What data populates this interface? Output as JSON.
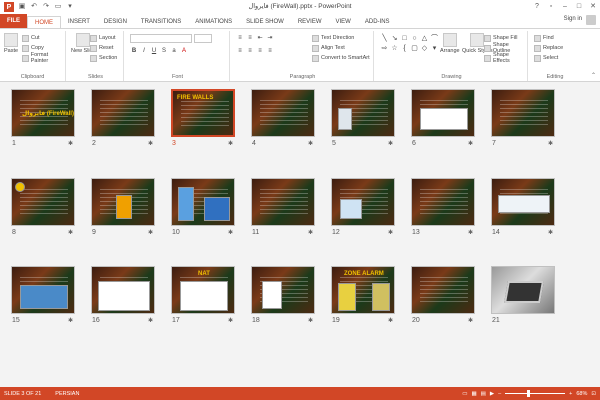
{
  "window": {
    "title": "فايروال (FireWall).pptx - PowerPoint"
  },
  "qat": {
    "logo": "P"
  },
  "tabs": [
    "FILE",
    "HOME",
    "INSERT",
    "DESIGN",
    "TRANSITIONS",
    "ANIMATIONS",
    "SLIDE SHOW",
    "REVIEW",
    "VIEW",
    "ADD-INS"
  ],
  "account": {
    "signin": "Sign in"
  },
  "ribbon": {
    "clipboard": {
      "label": "Clipboard",
      "paste": "Paste",
      "cut": "Cut",
      "copy": "Copy",
      "format_painter": "Format Painter"
    },
    "slides": {
      "label": "Slides",
      "new_slide": "New Slide",
      "layout": "Layout",
      "reset": "Reset",
      "section": "Section"
    },
    "font": {
      "label": "Font"
    },
    "paragraph": {
      "label": "Paragraph",
      "text_direction": "Text Direction",
      "align_text": "Align Text",
      "convert_smartart": "Convert to SmartArt"
    },
    "drawing": {
      "label": "Drawing",
      "arrange": "Arrange",
      "quick_styles": "Quick Styles",
      "shape_fill": "Shape Fill",
      "shape_outline": "Shape Outline",
      "shape_effects": "Shape Effects"
    },
    "editing": {
      "label": "Editing",
      "find": "Find",
      "replace": "Replace",
      "select": "Select"
    }
  },
  "slides": {
    "items": [
      {
        "n": "1",
        "title": "فايروال (FireWall)"
      },
      {
        "n": "2",
        "title": ""
      },
      {
        "n": "3",
        "title": "FIRE WALLS"
      },
      {
        "n": "4",
        "title": ""
      },
      {
        "n": "5",
        "title": ""
      },
      {
        "n": "6",
        "title": ""
      },
      {
        "n": "7",
        "title": ""
      },
      {
        "n": "8",
        "title": ""
      },
      {
        "n": "9",
        "title": ""
      },
      {
        "n": "10",
        "title": ""
      },
      {
        "n": "11",
        "title": ""
      },
      {
        "n": "12",
        "title": ""
      },
      {
        "n": "13",
        "title": ""
      },
      {
        "n": "14",
        "title": ""
      },
      {
        "n": "15",
        "title": ""
      },
      {
        "n": "16",
        "title": ""
      },
      {
        "n": "17",
        "title": "NAT"
      },
      {
        "n": "18",
        "title": ""
      },
      {
        "n": "19",
        "title": "ZONE ALARM"
      },
      {
        "n": "20",
        "title": ""
      },
      {
        "n": "21",
        "title": ""
      }
    ],
    "star": "✱"
  },
  "status": {
    "slide_info": "SLIDE 3 OF 21",
    "language": "PERSIAN",
    "zoom": "68%"
  },
  "colors": {
    "accent": "#d24726"
  }
}
